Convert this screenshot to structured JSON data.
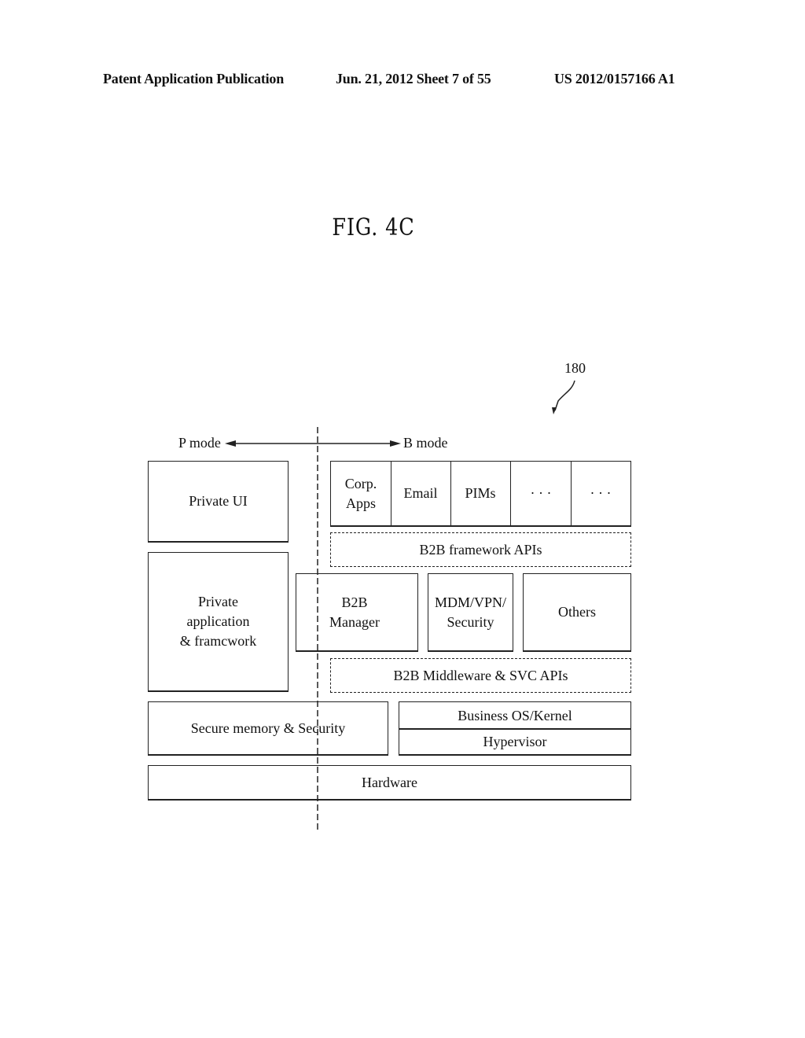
{
  "header": {
    "publication": "Patent Application Publication",
    "date_sheet": "Jun. 21, 2012  Sheet 7 of 55",
    "patent_number": "US 2012/0157166 A1"
  },
  "figure": {
    "title": "FIG. 4C",
    "reference_numeral": "180"
  },
  "modes": {
    "left": "P mode",
    "right": "B mode"
  },
  "blocks": {
    "private_ui": "Private UI",
    "private_app": "Private\napplication\n& framcwork",
    "apps": [
      "Corp.\nApps",
      "Email",
      "PIMs",
      "· · ·",
      "· · ·"
    ],
    "b2b_framework_apis": "B2B framework APIs",
    "b2b_manager": "B2B\nManager",
    "mdm_vpn_security": "MDM/VPN/\nSecurity",
    "others": "Others",
    "b2b_middleware": "B2B Middleware & SVC APIs",
    "secure_memory": "Secure memory & Security",
    "business_os": "Business OS/Kernel",
    "hypervisor": "Hypervisor",
    "hardware": "Hardware"
  }
}
